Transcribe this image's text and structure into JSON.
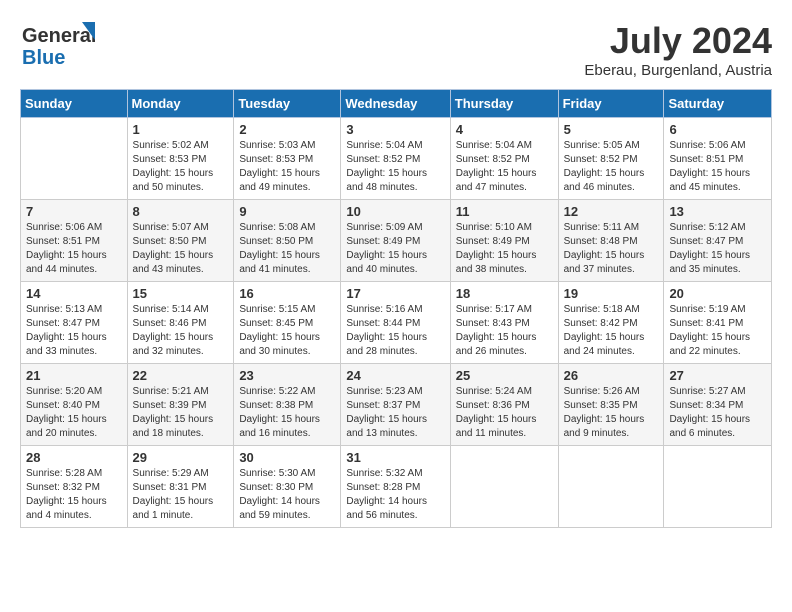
{
  "header": {
    "logo_line1": "General",
    "logo_line2": "Blue",
    "month_title": "July 2024",
    "location": "Eberau, Burgenland, Austria"
  },
  "weekdays": [
    "Sunday",
    "Monday",
    "Tuesday",
    "Wednesday",
    "Thursday",
    "Friday",
    "Saturday"
  ],
  "weeks": [
    [
      {
        "day": "",
        "sunrise": "",
        "sunset": "",
        "daylight": ""
      },
      {
        "day": "1",
        "sunrise": "Sunrise: 5:02 AM",
        "sunset": "Sunset: 8:53 PM",
        "daylight": "Daylight: 15 hours and 50 minutes."
      },
      {
        "day": "2",
        "sunrise": "Sunrise: 5:03 AM",
        "sunset": "Sunset: 8:53 PM",
        "daylight": "Daylight: 15 hours and 49 minutes."
      },
      {
        "day": "3",
        "sunrise": "Sunrise: 5:04 AM",
        "sunset": "Sunset: 8:52 PM",
        "daylight": "Daylight: 15 hours and 48 minutes."
      },
      {
        "day": "4",
        "sunrise": "Sunrise: 5:04 AM",
        "sunset": "Sunset: 8:52 PM",
        "daylight": "Daylight: 15 hours and 47 minutes."
      },
      {
        "day": "5",
        "sunrise": "Sunrise: 5:05 AM",
        "sunset": "Sunset: 8:52 PM",
        "daylight": "Daylight: 15 hours and 46 minutes."
      },
      {
        "day": "6",
        "sunrise": "Sunrise: 5:06 AM",
        "sunset": "Sunset: 8:51 PM",
        "daylight": "Daylight: 15 hours and 45 minutes."
      }
    ],
    [
      {
        "day": "7",
        "sunrise": "Sunrise: 5:06 AM",
        "sunset": "Sunset: 8:51 PM",
        "daylight": "Daylight: 15 hours and 44 minutes."
      },
      {
        "day": "8",
        "sunrise": "Sunrise: 5:07 AM",
        "sunset": "Sunset: 8:50 PM",
        "daylight": "Daylight: 15 hours and 43 minutes."
      },
      {
        "day": "9",
        "sunrise": "Sunrise: 5:08 AM",
        "sunset": "Sunset: 8:50 PM",
        "daylight": "Daylight: 15 hours and 41 minutes."
      },
      {
        "day": "10",
        "sunrise": "Sunrise: 5:09 AM",
        "sunset": "Sunset: 8:49 PM",
        "daylight": "Daylight: 15 hours and 40 minutes."
      },
      {
        "day": "11",
        "sunrise": "Sunrise: 5:10 AM",
        "sunset": "Sunset: 8:49 PM",
        "daylight": "Daylight: 15 hours and 38 minutes."
      },
      {
        "day": "12",
        "sunrise": "Sunrise: 5:11 AM",
        "sunset": "Sunset: 8:48 PM",
        "daylight": "Daylight: 15 hours and 37 minutes."
      },
      {
        "day": "13",
        "sunrise": "Sunrise: 5:12 AM",
        "sunset": "Sunset: 8:47 PM",
        "daylight": "Daylight: 15 hours and 35 minutes."
      }
    ],
    [
      {
        "day": "14",
        "sunrise": "Sunrise: 5:13 AM",
        "sunset": "Sunset: 8:47 PM",
        "daylight": "Daylight: 15 hours and 33 minutes."
      },
      {
        "day": "15",
        "sunrise": "Sunrise: 5:14 AM",
        "sunset": "Sunset: 8:46 PM",
        "daylight": "Daylight: 15 hours and 32 minutes."
      },
      {
        "day": "16",
        "sunrise": "Sunrise: 5:15 AM",
        "sunset": "Sunset: 8:45 PM",
        "daylight": "Daylight: 15 hours and 30 minutes."
      },
      {
        "day": "17",
        "sunrise": "Sunrise: 5:16 AM",
        "sunset": "Sunset: 8:44 PM",
        "daylight": "Daylight: 15 hours and 28 minutes."
      },
      {
        "day": "18",
        "sunrise": "Sunrise: 5:17 AM",
        "sunset": "Sunset: 8:43 PM",
        "daylight": "Daylight: 15 hours and 26 minutes."
      },
      {
        "day": "19",
        "sunrise": "Sunrise: 5:18 AM",
        "sunset": "Sunset: 8:42 PM",
        "daylight": "Daylight: 15 hours and 24 minutes."
      },
      {
        "day": "20",
        "sunrise": "Sunrise: 5:19 AM",
        "sunset": "Sunset: 8:41 PM",
        "daylight": "Daylight: 15 hours and 22 minutes."
      }
    ],
    [
      {
        "day": "21",
        "sunrise": "Sunrise: 5:20 AM",
        "sunset": "Sunset: 8:40 PM",
        "daylight": "Daylight: 15 hours and 20 minutes."
      },
      {
        "day": "22",
        "sunrise": "Sunrise: 5:21 AM",
        "sunset": "Sunset: 8:39 PM",
        "daylight": "Daylight: 15 hours and 18 minutes."
      },
      {
        "day": "23",
        "sunrise": "Sunrise: 5:22 AM",
        "sunset": "Sunset: 8:38 PM",
        "daylight": "Daylight: 15 hours and 16 minutes."
      },
      {
        "day": "24",
        "sunrise": "Sunrise: 5:23 AM",
        "sunset": "Sunset: 8:37 PM",
        "daylight": "Daylight: 15 hours and 13 minutes."
      },
      {
        "day": "25",
        "sunrise": "Sunrise: 5:24 AM",
        "sunset": "Sunset: 8:36 PM",
        "daylight": "Daylight: 15 hours and 11 minutes."
      },
      {
        "day": "26",
        "sunrise": "Sunrise: 5:26 AM",
        "sunset": "Sunset: 8:35 PM",
        "daylight": "Daylight: 15 hours and 9 minutes."
      },
      {
        "day": "27",
        "sunrise": "Sunrise: 5:27 AM",
        "sunset": "Sunset: 8:34 PM",
        "daylight": "Daylight: 15 hours and 6 minutes."
      }
    ],
    [
      {
        "day": "28",
        "sunrise": "Sunrise: 5:28 AM",
        "sunset": "Sunset: 8:32 PM",
        "daylight": "Daylight: 15 hours and 4 minutes."
      },
      {
        "day": "29",
        "sunrise": "Sunrise: 5:29 AM",
        "sunset": "Sunset: 8:31 PM",
        "daylight": "Daylight: 15 hours and 1 minute."
      },
      {
        "day": "30",
        "sunrise": "Sunrise: 5:30 AM",
        "sunset": "Sunset: 8:30 PM",
        "daylight": "Daylight: 14 hours and 59 minutes."
      },
      {
        "day": "31",
        "sunrise": "Sunrise: 5:32 AM",
        "sunset": "Sunset: 8:28 PM",
        "daylight": "Daylight: 14 hours and 56 minutes."
      },
      {
        "day": "",
        "sunrise": "",
        "sunset": "",
        "daylight": ""
      },
      {
        "day": "",
        "sunrise": "",
        "sunset": "",
        "daylight": ""
      },
      {
        "day": "",
        "sunrise": "",
        "sunset": "",
        "daylight": ""
      }
    ]
  ]
}
